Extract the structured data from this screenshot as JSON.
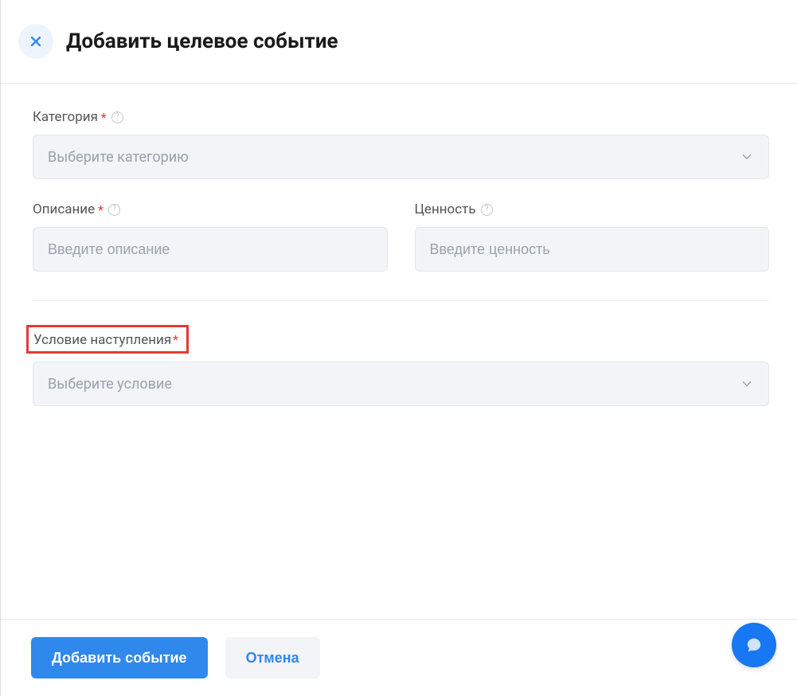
{
  "header": {
    "title": "Добавить целевое событие"
  },
  "fields": {
    "category": {
      "label": "Категория",
      "placeholder": "Выберите категорию"
    },
    "description": {
      "label": "Описание",
      "placeholder": "Введите описание"
    },
    "value": {
      "label": "Ценность",
      "placeholder": "Введите ценность"
    },
    "condition": {
      "label": "Условие наступления",
      "placeholder": "Выберите условие"
    }
  },
  "required_marker": "*",
  "footer": {
    "submit": "Добавить событие",
    "cancel": "Отмена"
  }
}
